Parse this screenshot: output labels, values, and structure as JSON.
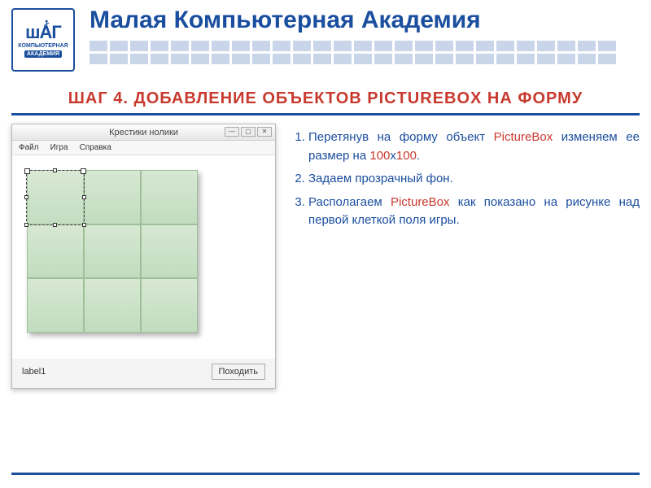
{
  "header": {
    "brand_title": "Малая Компьютерная Академия",
    "logo_word": "шАГ",
    "logo_sub_top": "КОМПЬЮТЕРНАЯ",
    "logo_sub_bot": "АКАДЕМИЯ"
  },
  "step_title": "ШАГ 4. ДОБАВЛЕНИЕ ОБЪЕКТОВ PICTUREBOX НА ФОРМУ",
  "screenshot": {
    "window_title": "Крестики нолики",
    "menu": {
      "file": "Файл",
      "game": "Игра",
      "help": "Справка"
    },
    "label": "label1",
    "button": "Походить",
    "ctrl_min": "—",
    "ctrl_max": "▢",
    "ctrl_close": "✕"
  },
  "steps": {
    "s1_a": "Перетянув на форму объект ",
    "s1_kw1": "PictureBox",
    "s1_b": " изменяем ее размер на ",
    "s1_kw2": "100",
    "s1_x": "х",
    "s1_kw3": "100",
    "s1_c": ".",
    "s2": "Задаем прозрачный фон.",
    "s3_a": "Располагаем ",
    "s3_kw": "PictureBox",
    "s3_b": " как показано на рисунке над первой клеткой поля игры."
  }
}
